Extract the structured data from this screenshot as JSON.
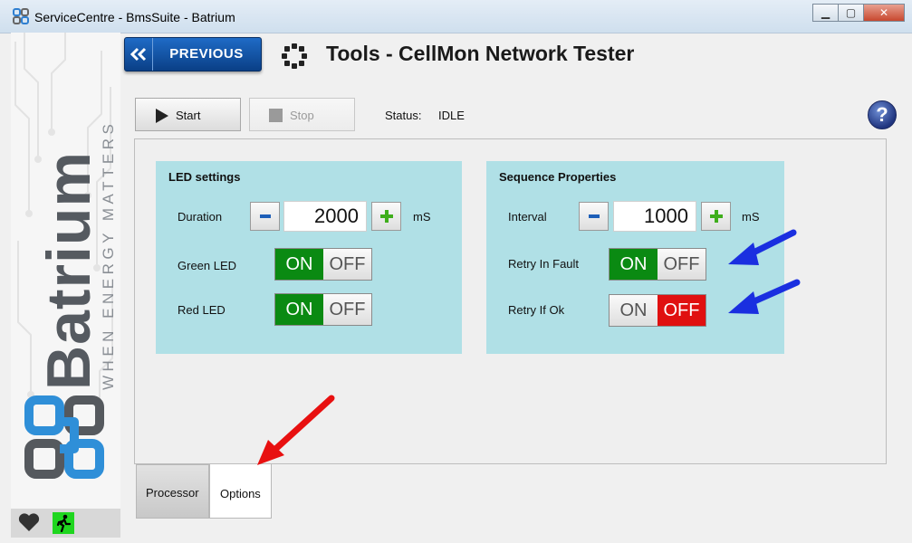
{
  "window": {
    "title": "ServiceCentre - BmsSuite - Batrium",
    "minimize_glyph": "▁",
    "maximize_glyph": "▢",
    "close_glyph": "✕"
  },
  "brand": {
    "name": "Batrium",
    "tagline": "WHEN ENERGY MATTERS"
  },
  "header": {
    "previous_label": "PREVIOUS",
    "page_title": "Tools - CellMon Network Tester"
  },
  "toolbar": {
    "start_label": "Start",
    "stop_label": "Stop",
    "status_label": "Status:",
    "status_value": "IDLE",
    "help_glyph": "?"
  },
  "led_settings": {
    "title": "LED settings",
    "duration_label": "Duration",
    "duration_value": "2000",
    "duration_unit": "mS",
    "green_led_label": "Green LED",
    "green_led_on": true,
    "red_led_label": "Red LED",
    "red_led_on": true
  },
  "sequence_properties": {
    "title": "Sequence Properties",
    "interval_label": "Interval",
    "interval_value": "1000",
    "interval_unit": "mS",
    "retry_in_fault_label": "Retry In Fault",
    "retry_in_fault_on": true,
    "retry_if_ok_label": "Retry If Ok",
    "retry_if_ok_on": false
  },
  "toggle_text": {
    "on": "ON",
    "off": "OFF"
  },
  "tabs": [
    {
      "label": "Processor",
      "active": false
    },
    {
      "label": "Options",
      "active": true
    }
  ],
  "colors": {
    "group_bg": "#b0e0e6",
    "toggle_on": "#0a8a12",
    "toggle_off": "#e01010",
    "stepper_icon_minus": "#1e5fb8",
    "stepper_icon_plus": "#3fae1c",
    "arrow_blue": "#1a2fe0",
    "arrow_red": "#e81010"
  },
  "icons": [
    "app-icon",
    "chevron-double-left-icon",
    "tools-icon",
    "play-icon",
    "stop-icon",
    "help-icon",
    "heart-icon",
    "exit-icon"
  ]
}
